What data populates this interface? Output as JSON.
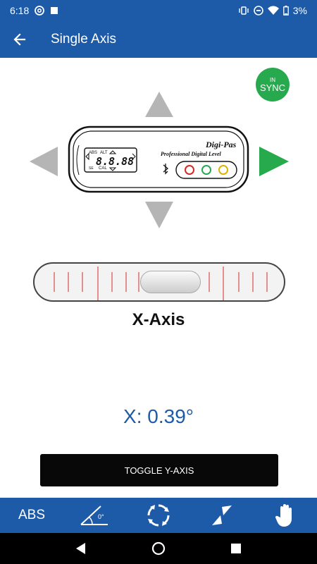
{
  "status_bar": {
    "time": "6:18",
    "battery": "3%",
    "icons": [
      "at-sign-icon",
      "square-icon",
      "vibrate-icon",
      "do-not-disturb-icon",
      "wifi-icon",
      "battery-icon"
    ]
  },
  "app_bar": {
    "title": "Single Axis",
    "back_icon": "arrow-left-icon"
  },
  "sync_badge": {
    "line1": "IN",
    "line2": "SYNC",
    "color": "#27a94e"
  },
  "device": {
    "brand": "Digi-Pas",
    "subtitle": "Professional Digital Level",
    "display_left": "ABS",
    "display_right": "ALT",
    "display_value": "8.8.88",
    "display_bottom_left": "SE",
    "display_bottom_right": "CAL"
  },
  "arrows": {
    "up_color": "#b5b5b5",
    "down_color": "#b5b5b5",
    "left_color": "#b5b5b5",
    "right_color": "#27a94e"
  },
  "level": {
    "axis_label": "X-Axis"
  },
  "reading": {
    "text": "X: 0.39°"
  },
  "toggle_button": {
    "label": "TOGGLE Y-AXIS"
  },
  "toolbar": {
    "items": [
      {
        "label": "ABS",
        "icon": "abs-text"
      },
      {
        "label": "0°",
        "icon": "angle-zero-icon"
      },
      {
        "label": "",
        "icon": "rotate-calibrate-icon"
      },
      {
        "label": "",
        "icon": "level-arrows-icon"
      },
      {
        "label": "",
        "icon": "hand-icon"
      }
    ]
  },
  "nav_bar": {
    "back": "back-triangle-icon",
    "home": "home-circle-icon",
    "recents": "recents-square-icon"
  },
  "colors": {
    "primary": "#1d5aa8",
    "accent_green": "#27a94e",
    "reading_blue": "#1d5aa8"
  }
}
